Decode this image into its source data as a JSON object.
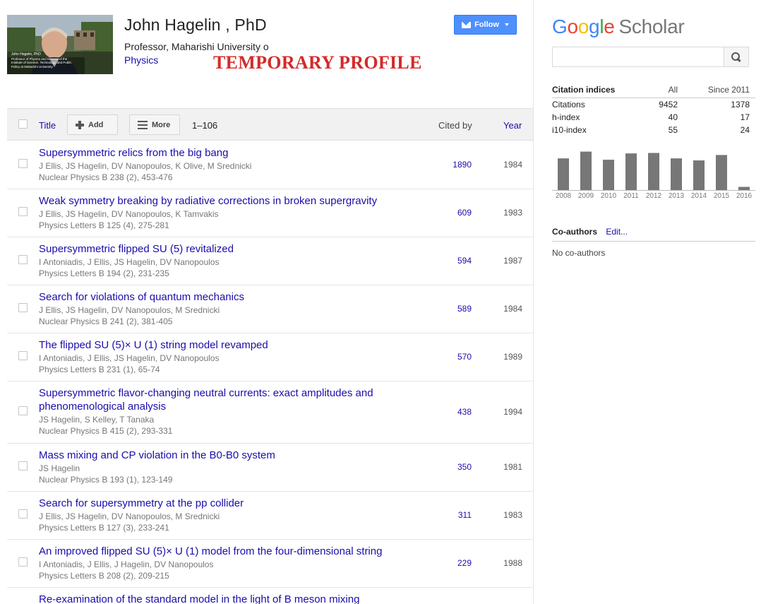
{
  "profile": {
    "name": "John Hagelin , PhD",
    "affiliation": "Professor, Maharishi University of Management",
    "interest": "Physics",
    "photo_caption_name": "John Hagelin, PhD",
    "photo_caption": "Professor of Physics and Director of the Institute of Science, Technology and Public Policy at Maharishi University",
    "banner": "TEMPORARY PROFILE",
    "follow_label": "Follow"
  },
  "table": {
    "title_header": "Title",
    "add_label": "Add",
    "more_label": "More",
    "range": "1–106",
    "cited_header": "Cited by",
    "year_header": "Year"
  },
  "articles": [
    {
      "title": "Supersymmetric relics from the big bang",
      "authors": "J Ellis, JS Hagelin, DV Nanopoulos, K Olive, M Srednicki",
      "venue": "Nuclear Physics B 238 (2), 453-476",
      "cited": "1890",
      "year": "1984"
    },
    {
      "title": "Weak symmetry breaking by radiative corrections in broken supergravity",
      "authors": "J Ellis, JS Hagelin, DV Nanopoulos, K Tamvakis",
      "venue": "Physics Letters B 125 (4), 275-281",
      "cited": "609",
      "year": "1983"
    },
    {
      "title": "Supersymmetric flipped SU (5) revitalized",
      "authors": "I Antoniadis, J Ellis, JS Hagelin, DV Nanopoulos",
      "venue": "Physics Letters B 194 (2), 231-235",
      "cited": "594",
      "year": "1987"
    },
    {
      "title": "Search for violations of quantum mechanics",
      "authors": "J Ellis, JS Hagelin, DV Nanopoulos, M Srednicki",
      "venue": "Nuclear Physics B 241 (2), 381-405",
      "cited": "589",
      "year": "1984"
    },
    {
      "title": "The flipped SU (5)× U (1) string model revamped",
      "authors": "I Antoniadis, J Ellis, JS Hagelin, DV Nanopoulos",
      "venue": "Physics Letters B 231 (1), 65-74",
      "cited": "570",
      "year": "1989"
    },
    {
      "title": "Supersymmetric flavor-changing neutral currents: exact amplitudes and phenomenological analysis",
      "authors": "JS Hagelin, S Kelley, T Tanaka",
      "venue": "Nuclear Physics B 415 (2), 293-331",
      "cited": "438",
      "year": "1994"
    },
    {
      "title": "Mass mixing and CP violation in the B0-B0 system",
      "authors": "JS Hagelin",
      "venue": "Nuclear Physics B 193 (1), 123-149",
      "cited": "350",
      "year": "1981"
    },
    {
      "title": "Search for supersymmetry at the pp collider",
      "authors": "J Ellis, JS Hagelin, DV Nanopoulos, M Srednicki",
      "venue": "Physics Letters B 127 (3), 233-241",
      "cited": "311",
      "year": "1983"
    },
    {
      "title": "An improved flipped SU (5)× U (1) model from the four-dimensional string",
      "authors": "I Antoniadis, J Ellis, J Hagelin, DV Nanopoulos",
      "venue": "Physics Letters B 208 (2), 209-215",
      "cited": "229",
      "year": "1988"
    },
    {
      "title": "Re-examination of the standard model in the light of B meson mixing",
      "authors": "",
      "venue": "",
      "cited": "",
      "year": ""
    }
  ],
  "sidebar": {
    "logo_google": "Google",
    "logo_scholar": "Scholar",
    "search_placeholder": "",
    "citation_indices": {
      "title": "Citation indices",
      "col_all": "All",
      "col_since": "Since 2011",
      "rows": [
        {
          "label": "Citations",
          "all": "9452",
          "since": "1378"
        },
        {
          "label": "h-index",
          "all": "40",
          "since": "17"
        },
        {
          "label": "i10-index",
          "all": "55",
          "since": "24"
        }
      ]
    },
    "coauthors_title": "Co-authors",
    "coauthors_edit": "Edit...",
    "no_coauthors": "No co-authors"
  },
  "colors": {
    "link": "#1a0dab",
    "follow_button": "#4d90fe",
    "banner_red": "#d42a2a",
    "bar_gray": "#777777"
  },
  "chart_data": {
    "type": "bar",
    "categories": [
      "2008",
      "2009",
      "2010",
      "2011",
      "2012",
      "2013",
      "2014",
      "2015",
      "2016"
    ],
    "values": [
      140,
      170,
      134,
      162,
      164,
      140,
      131,
      155,
      14
    ],
    "ylim": [
      0,
      200
    ]
  }
}
